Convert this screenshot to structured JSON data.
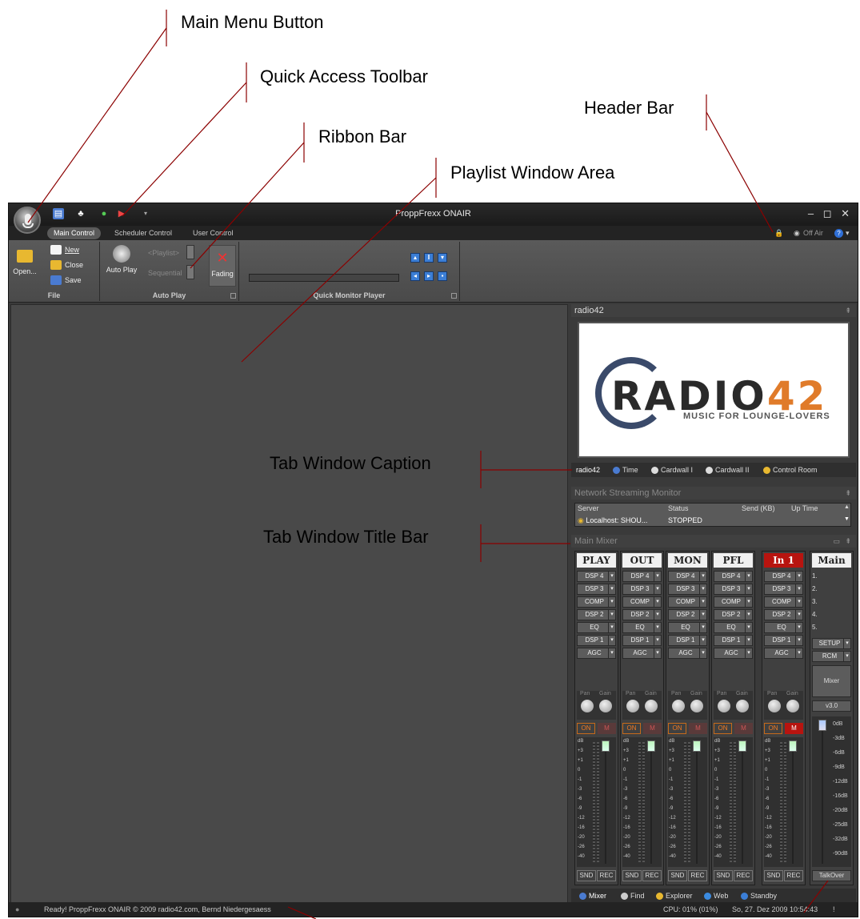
{
  "annotations": {
    "main_menu_button": "Main Menu Button",
    "quick_access_toolbar": "Quick Access Toolbar",
    "ribbon_bar": "Ribbon Bar",
    "header_bar": "Header Bar",
    "playlist_window_area": "Playlist Window Area",
    "tab_window_caption": "Tab Window Caption",
    "tab_window_title_bar": "Tab Window Title Bar"
  },
  "window": {
    "title": "ProppFrexx ONAIR",
    "controls": "– ◻ ✕"
  },
  "ribbon_tabs": [
    {
      "label": "Main Control",
      "active": true
    },
    {
      "label": "Scheduler Control",
      "active": false
    },
    {
      "label": "User Control",
      "active": false
    }
  ],
  "header": {
    "status": "Off Air",
    "help": "?"
  },
  "ribbon": {
    "file": {
      "label": "File",
      "open": "Open...",
      "new": "New",
      "close": "Close",
      "save": "Save"
    },
    "autoplay": {
      "label": "Auto Play",
      "button": "Auto Play",
      "playlist": "<Playlist>",
      "mode": "Sequential",
      "fading": "Fading"
    },
    "qmp": {
      "label": "Quick Monitor Player"
    }
  },
  "radio_panel": {
    "title": "radio42",
    "logo_text": "RADIO",
    "logo_num": "42",
    "logo_sub": "MUSIC FOR LOUNGE-LOVERS",
    "tabs": [
      "radio42",
      "Time",
      "Cardwall I",
      "Cardwall II",
      "Control Room"
    ]
  },
  "network_monitor": {
    "title": "Network Streaming Monitor",
    "columns": [
      "Server",
      "Status",
      "Send (KB)",
      "Up Time"
    ],
    "row": {
      "server": "Localhost: SHOU...",
      "status": "STOPPED"
    }
  },
  "mixer": {
    "title": "Main Mixer",
    "channels": [
      {
        "name": "PLAY",
        "red": false,
        "mute_active": false
      },
      {
        "name": "OUT",
        "red": false,
        "mute_active": false
      },
      {
        "name": "MON",
        "red": false,
        "mute_active": false
      },
      {
        "name": "PFL",
        "red": false,
        "mute_active": false
      },
      {
        "name": "In 1",
        "red": true,
        "mute_active": true
      }
    ],
    "slots": [
      "DSP 4",
      "DSP 3",
      "COMP",
      "DSP 2",
      "EQ",
      "DSP 1",
      "AGC"
    ],
    "pan_label": "Pan",
    "gain_label": "Gain",
    "on_label": "ON",
    "mute_label": "M",
    "scale": [
      "dB",
      "+3",
      "+1",
      "0",
      "-1",
      "-3",
      "-6",
      "-9",
      "-12",
      "-16",
      "-20",
      "-26",
      "-40"
    ],
    "snd_label": "SND",
    "rec_label": "REC",
    "main": {
      "name": "Main",
      "list": [
        "1.",
        "2.",
        "3.",
        "4.",
        "5."
      ],
      "setup": "SETUP",
      "rcm": "RCM",
      "mixer": "Mixer",
      "version": "v3.0",
      "talkover": "TalkOver",
      "scale": [
        "0dB",
        "-3dB",
        "-6dB",
        "-9dB",
        "-12dB",
        "-16dB",
        "-20dB",
        "-25dB",
        "-32dB",
        "-90dB"
      ]
    },
    "bottom_tabs": [
      "Mixer",
      "Find",
      "Explorer",
      "Web",
      "Standby"
    ]
  },
  "statusbar": {
    "left": "Ready!  ProppFrexx ONAIR © 2009 radio42.com, Bernd Niedergesaess",
    "cpu": "CPU: 01% (01%)",
    "datetime": "So, 27. Dez 2009 10:54:43"
  }
}
